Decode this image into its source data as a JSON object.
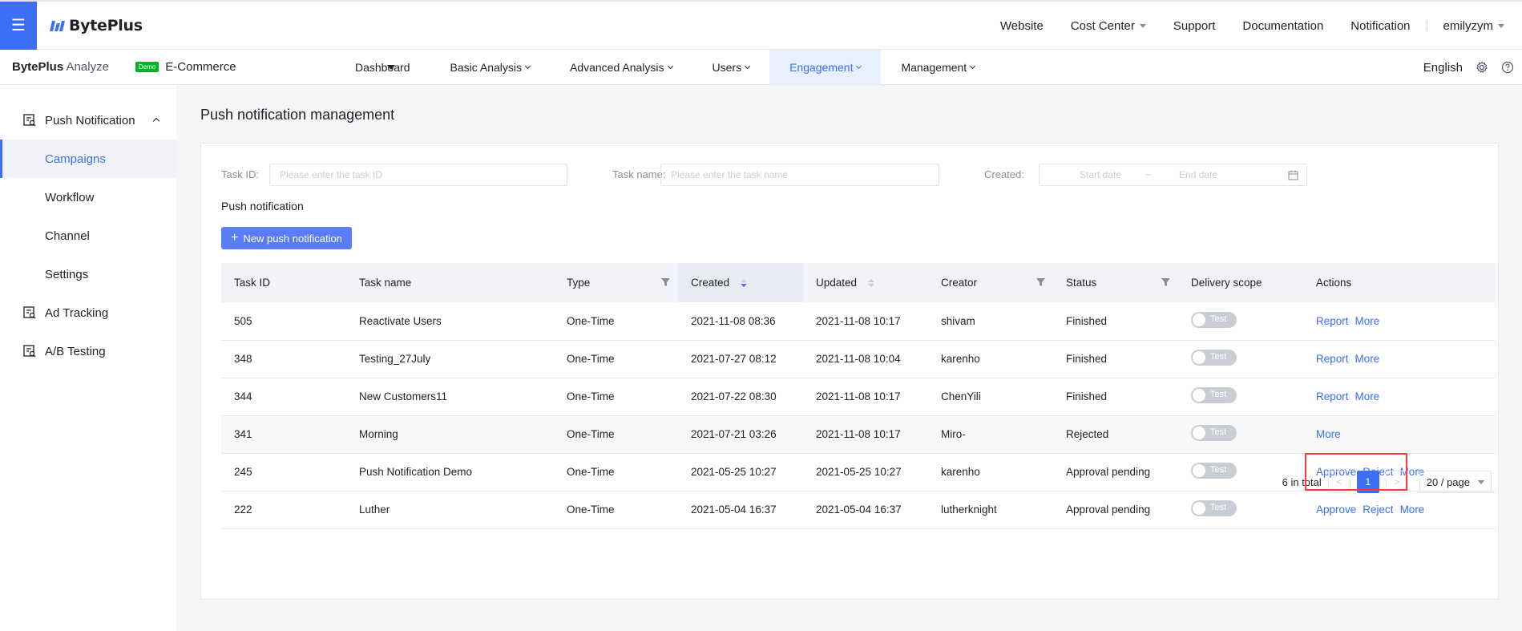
{
  "topbar": {
    "logo_text": "BytePlus",
    "nav": [
      "Website",
      "Cost Center",
      "Support",
      "Documentation",
      "Notification"
    ],
    "user": "emilyzym"
  },
  "subbar": {
    "brand_bold": "BytePlus",
    "brand_light": " Analyze",
    "demo_badge": "Demo",
    "app_name": "E-Commerce",
    "nav": [
      "Dashboard",
      "Basic Analysis",
      "Advanced Analysis",
      "Users",
      "Engagement",
      "Management"
    ],
    "language": "English"
  },
  "sidebar": {
    "group_push": "Push Notification",
    "items": [
      "Campaigns",
      "Workflow",
      "Channel",
      "Settings"
    ],
    "group_ad": "Ad Tracking",
    "group_ab": "A/B Testing"
  },
  "page": {
    "title": "Push notification management",
    "section_title": "Push notification",
    "new_button": "New push notification"
  },
  "filters": {
    "task_id_label": "Task ID:",
    "task_id_placeholder": "Please enter the task ID",
    "task_name_label": "Task name:",
    "task_name_placeholder": "Please enter the task name",
    "created_label": "Created:",
    "start_placeholder": "Start date",
    "range_sep": "~",
    "end_placeholder": "End date"
  },
  "table": {
    "columns": [
      "Task ID",
      "Task name",
      "Type",
      "Created",
      "Updated",
      "Creator",
      "Status",
      "Delivery scope",
      "Actions"
    ],
    "toggle_label": "Test",
    "rows": [
      {
        "id": "505",
        "name": "Reactivate Users",
        "type": "One-Time",
        "created": "2021-11-08 08:36",
        "updated": "2021-11-08 10:17",
        "creator": "shivam",
        "status": "Finished",
        "actions": [
          "Report",
          "More"
        ]
      },
      {
        "id": "348",
        "name": "Testing_27July",
        "type": "One-Time",
        "created": "2021-07-27 08:12",
        "updated": "2021-11-08 10:04",
        "creator": "karenho",
        "status": "Finished",
        "actions": [
          "Report",
          "More"
        ]
      },
      {
        "id": "344",
        "name": "New Customers11",
        "type": "One-Time",
        "created": "2021-07-22 08:30",
        "updated": "2021-11-08 10:17",
        "creator": "ChenYili",
        "status": "Finished",
        "actions": [
          "Report",
          "More"
        ]
      },
      {
        "id": "341",
        "name": "Morning",
        "type": "One-Time",
        "created": "2021-07-21 03:26",
        "updated": "2021-11-08 10:17",
        "creator": "Miro-",
        "status": "Rejected",
        "actions": [
          "More"
        ]
      },
      {
        "id": "245",
        "name": "Push Notification Demo",
        "type": "One-Time",
        "created": "2021-05-25 10:27",
        "updated": "2021-05-25 10:27",
        "creator": "karenho",
        "status": "Approval pending",
        "actions": [
          "Approve",
          "Reject",
          "More"
        ]
      },
      {
        "id": "222",
        "name": "Luther",
        "type": "One-Time",
        "created": "2021-05-04 16:37",
        "updated": "2021-05-04 16:37",
        "creator": "lutherknight",
        "status": "Approval pending",
        "actions": [
          "Approve",
          "Reject",
          "More"
        ]
      }
    ]
  },
  "pagination": {
    "total": "6 in total",
    "prev": "<",
    "current": "1",
    "next": ">",
    "page_size": "20 / page"
  },
  "colors": {
    "accent": "#3c6ef6",
    "highlight": "#f53f3f"
  }
}
